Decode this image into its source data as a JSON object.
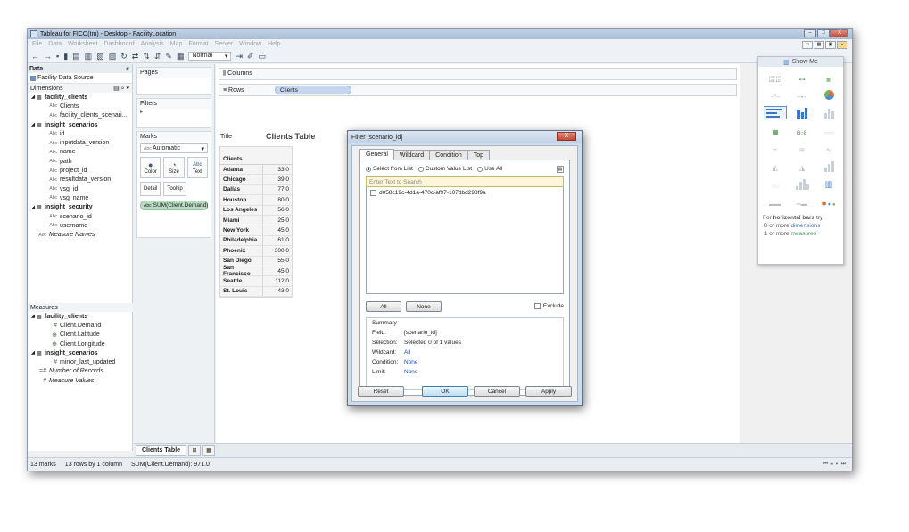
{
  "window": {
    "title": "Tableau for FICO(tm) - Desktop - FacilityLocation",
    "controls": [
      "–",
      "□",
      "X"
    ]
  },
  "menu": [
    "File",
    "Data",
    "Worksheet",
    "Dashboard",
    "Analysis",
    "Map",
    "Format",
    "Server",
    "Window",
    "Help"
  ],
  "toolbar": {
    "fit_select": "Normal"
  },
  "data_pane": {
    "header": "Data",
    "data_source": "Facility Data Source",
    "dimensions_label": "Dimensions",
    "dimensions": [
      {
        "kind": "group",
        "name": "facility_clients"
      },
      {
        "kind": "field",
        "type": "Abc",
        "name": "Clients"
      },
      {
        "kind": "field",
        "type": "Abc",
        "name": "facility_clients_scenari..."
      },
      {
        "kind": "group",
        "name": "insight_scenarios"
      },
      {
        "kind": "field",
        "type": "Abc",
        "name": "id"
      },
      {
        "kind": "field",
        "type": "Abc",
        "name": "inputdata_version"
      },
      {
        "kind": "field",
        "type": "Abc",
        "name": "name"
      },
      {
        "kind": "field",
        "type": "Abc",
        "name": "path"
      },
      {
        "kind": "field",
        "type": "Abc",
        "name": "project_id"
      },
      {
        "kind": "field",
        "type": "Abc",
        "name": "resultdata_version"
      },
      {
        "kind": "field",
        "type": "Abc",
        "name": "vsg_id"
      },
      {
        "kind": "field",
        "type": "Abc",
        "name": "vsg_name"
      },
      {
        "kind": "group",
        "name": "insight_security"
      },
      {
        "kind": "field",
        "type": "Abc",
        "name": "scenario_id"
      },
      {
        "kind": "field",
        "type": "Abc",
        "name": "username"
      },
      {
        "kind": "root",
        "type": "Abc",
        "name": "Measure Names"
      }
    ],
    "measures_label": "Measures",
    "measures": [
      {
        "kind": "group",
        "name": "facility_clients"
      },
      {
        "kind": "field",
        "type": "#",
        "name": "Client.Demand"
      },
      {
        "kind": "field",
        "type": "⊕",
        "name": "Client.Latitude"
      },
      {
        "kind": "field",
        "type": "⊕",
        "name": "Client.Longitude"
      },
      {
        "kind": "group",
        "name": "insight_scenarios"
      },
      {
        "kind": "field",
        "type": "#",
        "name": "mirror_last_updated"
      },
      {
        "kind": "root",
        "type": "=#",
        "name": "Number of Records"
      },
      {
        "kind": "root",
        "type": "#",
        "name": "Measure Values"
      }
    ]
  },
  "shelves": {
    "pages": "Pages",
    "filters": "Filters",
    "marks": "Marks",
    "marks_type": "Automatic",
    "marks_buttons": [
      "Color",
      "Size",
      "Text"
    ],
    "marks_buttons2": [
      "Detail",
      "Tooltip"
    ],
    "sum_pill": "SUM(Client.Demand)"
  },
  "canvas": {
    "columns_label": "Columns",
    "rows_label": "Rows",
    "rows_pill": "Clients",
    "title_label": "Title",
    "sheet_title": "Clients Table",
    "table_header": "Clients",
    "rows": [
      {
        "city": "Atlanta",
        "value": "33.0"
      },
      {
        "city": "Chicago",
        "value": "39.0"
      },
      {
        "city": "Dallas",
        "value": "77.0"
      },
      {
        "city": "Houston",
        "value": "80.0"
      },
      {
        "city": "Los Angeles",
        "value": "56.0"
      },
      {
        "city": "Miami",
        "value": "25.0"
      },
      {
        "city": "New York",
        "value": "45.0"
      },
      {
        "city": "Philadelphia",
        "value": "61.0"
      },
      {
        "city": "Phoenix",
        "value": "300.0"
      },
      {
        "city": "San Diego",
        "value": "55.0"
      },
      {
        "city": "San Francisco",
        "value": "45.0"
      },
      {
        "city": "Seattle",
        "value": "112.0"
      },
      {
        "city": "St. Louis",
        "value": "43.0"
      }
    ]
  },
  "show_me": {
    "header": "Show Me",
    "hint_pre": "For ",
    "hint_bold": "horizontal bars",
    "hint_post": " try",
    "hint_line2_pre": "0 or more ",
    "hint_line2_hl": "dimensions",
    "hint_line3_pre": "1 or more ",
    "hint_line3_hl": "measures"
  },
  "sheet_tabs": {
    "active": "Clients Table"
  },
  "status": {
    "marks": "13 marks",
    "rows": "13 rows by 1 column",
    "sum": "SUM(Client.Demand): 971.0"
  },
  "dialog": {
    "title": "Filter [scenario_id]",
    "close": "X",
    "tabs": [
      "General",
      "Wildcard",
      "Condition",
      "Top"
    ],
    "radios": [
      "Select from List",
      "Custom Value List",
      "Use All"
    ],
    "search_placeholder": "Enter Text to Search",
    "values": [
      "d058c19c-4d1a-470c-af97-107dbd298f9a"
    ],
    "all_btn": "All",
    "none_btn": "None",
    "exclude": "Exclude",
    "summary_title": "Summary",
    "summary": {
      "field_k": "Field:",
      "field_v": "[scenario_id]",
      "selection_k": "Selection:",
      "selection_v": "Selected 0 of 1 values",
      "wildcard_k": "Wildcard:",
      "wildcard_v": "All",
      "condition_k": "Condition:",
      "condition_v": "None",
      "limit_k": "Limit:",
      "limit_v": "None"
    },
    "reset": "Reset",
    "ok": "OK",
    "cancel": "Cancel",
    "apply": "Apply"
  }
}
